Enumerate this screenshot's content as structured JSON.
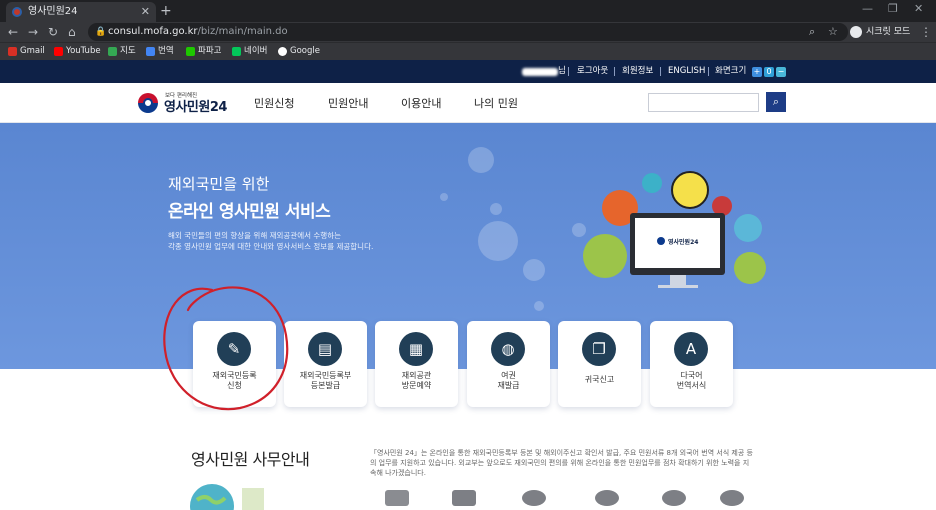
{
  "browser": {
    "tab_title": "영사민원24",
    "tab_close": "✕",
    "new_tab": "+",
    "url_host": "consul.mofa.go.kr",
    "url_path": "/biz/main/main.do",
    "profile_label": "시크릿 모드",
    "bookmarks": [
      {
        "label": "Gmail",
        "color": "#d93025"
      },
      {
        "label": "YouTube",
        "color": "#ff0000"
      },
      {
        "label": "지도",
        "color": "#34a853"
      },
      {
        "label": "번역",
        "color": "#4285f4"
      },
      {
        "label": "파파고",
        "color": "#1ec800"
      },
      {
        "label": "네이버",
        "color": "#03c75a"
      },
      {
        "label": "Google",
        "color": "#ffffff"
      }
    ]
  },
  "utility": {
    "suffix": "님",
    "logout": "로그아웃",
    "member_info": "회원정보",
    "english": "ENGLISH",
    "screen_size": "화면크기",
    "fs_plus": "+",
    "fs_reset": "0",
    "fs_minus": "−"
  },
  "logo": {
    "sub": "보다 편리해진",
    "name": "영사민원24"
  },
  "menu": [
    "민원신청",
    "민원안내",
    "이용안내",
    "나의 민원"
  ],
  "search": {
    "placeholder": "",
    "button_icon": "search-icon"
  },
  "hero": {
    "kicker": "재외국민을 위한",
    "title": "온라인 영사민원 서비스",
    "desc_line1": "해외 국민들의 편의 향상을 위해 재외공관에서 수행하는",
    "desc_line2": "각종 영사민원 업무에 대한 안내와 영사서비스 정보를 제공합니다.",
    "screen_logo": "영사민원24"
  },
  "cards": [
    {
      "line1": "재외국민등록",
      "line2": "신청",
      "icon": "document-check-icon"
    },
    {
      "line1": "재외국민등록부",
      "line2": "등본발급",
      "icon": "certificate-icon"
    },
    {
      "line1": "재외공관",
      "line2": "방문예약",
      "icon": "calendar-icon"
    },
    {
      "line1": "여권",
      "line2": "재발급",
      "icon": "passport-icon"
    },
    {
      "line1": "귀국신고",
      "line2": "",
      "icon": "cards-icon"
    },
    {
      "line1": "다국어",
      "line2": "번역서식",
      "icon": "translate-icon"
    }
  ],
  "section": {
    "title": "영사민원 사무안내",
    "desc": "「영사민원 24」는 온라인을 통한 재외국민등록부 등본 및 해외이주신고 확인서 발급, 주요 민원서류 8개 외국어 번역 서식 제공 등의 업무를 지원하고 있습니다. 외교부는 앞으로도 재외국민의 편의를 위해 온라인을 통한 민원업무를 점차 확대하기 위한 노력을 지속해 나가겠습니다."
  },
  "colors": {
    "navy": "#0e2147",
    "hero_blue": "#5a86d1",
    "card_icon": "#213f57",
    "annotation": "#d0202a"
  }
}
